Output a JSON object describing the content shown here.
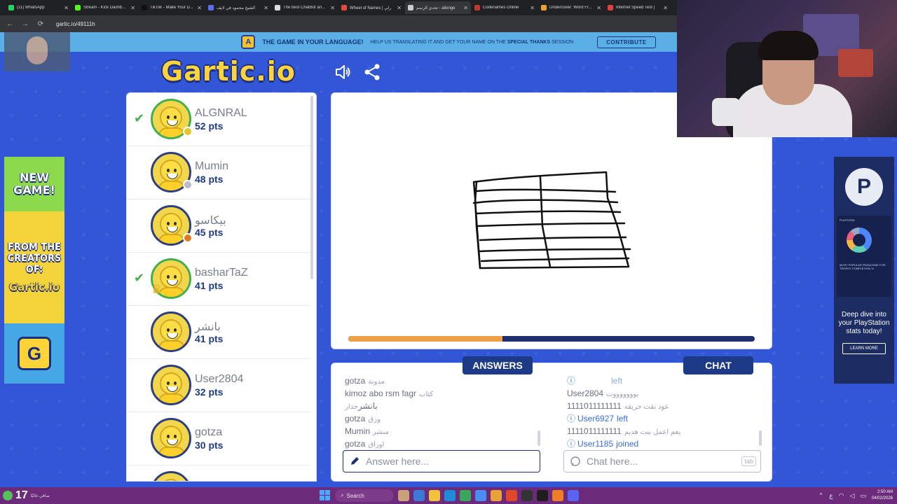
{
  "browser": {
    "tabs": [
      {
        "title": "(11) WhatsApp",
        "color": "#25d366"
      },
      {
        "title": "Stream - Kick Dashb...",
        "color": "#53fc18"
      },
      {
        "title": "TikTok - Make Your D...",
        "color": "#111111"
      },
      {
        "title": "الشيخ محمود في لايف",
        "color": "#5b6df0"
      },
      {
        "title": "The best ChatBot an...",
        "color": "#dddddd"
      },
      {
        "title": "Wheel of Names | رلي",
        "color": "#e44b3a"
      },
      {
        "title": "تحدي الرسم - allenge",
        "color": "#cccccc"
      },
      {
        "title": "Codenames Online",
        "color": "#c0392b"
      },
      {
        "title": "Undercover: Word Fr...",
        "color": "#f0a030"
      },
      {
        "title": "Internet Speed Test |",
        "color": "#e04040"
      }
    ],
    "close_glyph": "✕",
    "url": "gartic.io/49111h",
    "nav": {
      "back": "←",
      "forward": "→",
      "reload": "⟳"
    }
  },
  "banner": {
    "icon": "A",
    "title": "THE GAME IN YOUR LANGUAGE!",
    "sub_prefix": "HELP US TRANSLATING IT AND GET YOUR NAME ON THE",
    "sub_bold": "SPECIAL THANKS",
    "sub_suffix": "SESSION",
    "contribute": "CONTRIBUTE"
  },
  "logo": "Gartic.io",
  "players": [
    {
      "name": "ALGNRAL",
      "pts": "52 pts",
      "guessed": true,
      "status": "#e6c22b",
      "ring": "green",
      "trophy": false
    },
    {
      "name": "Mumin",
      "pts": "48 pts",
      "guessed": false,
      "status": "#b8bcc8",
      "ring": "blue",
      "trophy": false
    },
    {
      "name": "بيكاسو",
      "pts": "45 pts",
      "guessed": false,
      "status": "#e07a1f",
      "ring": "blue",
      "trophy": false
    },
    {
      "name": "basharTaZ",
      "pts": "41 pts",
      "guessed": true,
      "status": "",
      "ring": "green",
      "trophy": true
    },
    {
      "name": "بانشر",
      "pts": "41 pts",
      "guessed": false,
      "status": "",
      "ring": "blue",
      "trophy": false
    },
    {
      "name": "User2804",
      "pts": "32 pts",
      "guessed": false,
      "status": "",
      "ring": "blue",
      "trophy": false
    },
    {
      "name": "gotza",
      "pts": "30 pts",
      "guessed": false,
      "status": "",
      "ring": "blue",
      "trophy": false
    },
    {
      "name": "",
      "pts": "",
      "guessed": false,
      "status": "",
      "ring": "blue",
      "trophy": false
    }
  ],
  "timer": {
    "progress": 0.38,
    "fill_color": "#f0a048",
    "track_color": "#1d2f6c"
  },
  "answers": {
    "tab": "ANSWERS",
    "messages": [
      {
        "user": "gotza",
        "text": "مدونة"
      },
      {
        "user": "kimoz abo rsm fagr",
        "text": "كتاب"
      },
      {
        "user": "بانشر",
        "text": "جدار"
      },
      {
        "user": "gotza",
        "text": "ورق"
      },
      {
        "user": "Mumin",
        "text": "منشر"
      },
      {
        "user": "gotza",
        "text": "اوراق"
      }
    ],
    "placeholder": "Answer here..."
  },
  "chat": {
    "tab": "CHAT",
    "messages": [
      {
        "info": true,
        "user": "",
        "text": "left",
        "faded": true
      },
      {
        "info": false,
        "user": "User2804",
        "text": "بوووووووت"
      },
      {
        "info": false,
        "user": "1111011111111",
        "text": "عود بقت حريقه"
      },
      {
        "info": true,
        "user": "User6927",
        "text": "left"
      },
      {
        "info": false,
        "user": "1111011111111",
        "text": "يعم اعمل بنت هديم"
      },
      {
        "info": true,
        "user": "User1185",
        "text": "joined"
      }
    ],
    "placeholder": "Chat here...",
    "tab_hint": "tab"
  },
  "ad_left": {
    "top": "NEW GAME!",
    "mid": "FROM THE CREATORS OF:",
    "mini_logo": "Gartic.io",
    "badge": "G"
  },
  "ad_right": {
    "logo": "P",
    "card_title": "PLATFORM",
    "card_sub": "MOST POPULAR FRANCHISE FOR TROPHY COMPLETION %",
    "headline": "Deep dive into your PlayStation stats today!",
    "cta": "LEARN MORE"
  },
  "taskbar": {
    "temp": "17",
    "weather": "صافي غالبًا",
    "search": "Search",
    "time": "2:50 AM",
    "date": "04/02/2026",
    "lang": "ع"
  }
}
